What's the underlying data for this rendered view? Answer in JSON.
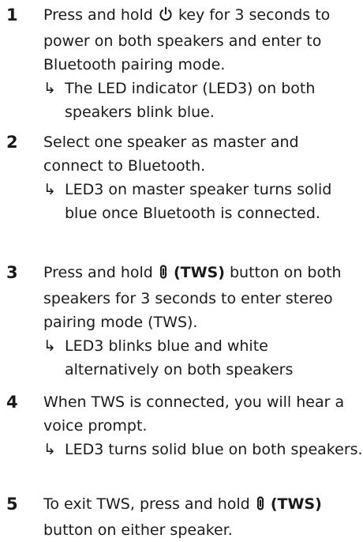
{
  "steps": [
    {
      "number": "1",
      "text_before": "Press and hold",
      "icon": "power-icon",
      "text_after": "key for 3 seconds to power on both speakers and enter to Bluetooth pairing mode.",
      "result": "The LED indicator (LED3) on both speakers blink blue."
    },
    {
      "number": "2",
      "text": "Select one speaker as master and connect to Bluetooth.",
      "result": "LED3 on master speaker turns solid blue once Bluetooth is connected."
    },
    {
      "number": "3",
      "text_before": "Press and hold",
      "icon": "tws-link-icon",
      "button_label": "(TWS)",
      "text_after": "button on both speakers for 3 seconds to enter stereo pairing mode (TWS).",
      "result": "LED3 blinks blue and white alternatively on both speakers"
    },
    {
      "number": "4",
      "text": "When TWS is connected, you will hear a voice prompt.",
      "result": "LED3 turns solid blue on both speakers."
    },
    {
      "number": "5",
      "text_before": "To exit TWS, press and hold",
      "icon": "tws-link-icon",
      "button_label": "(TWS)",
      "text_after": "button on either speaker."
    }
  ],
  "result_arrow": "↳"
}
